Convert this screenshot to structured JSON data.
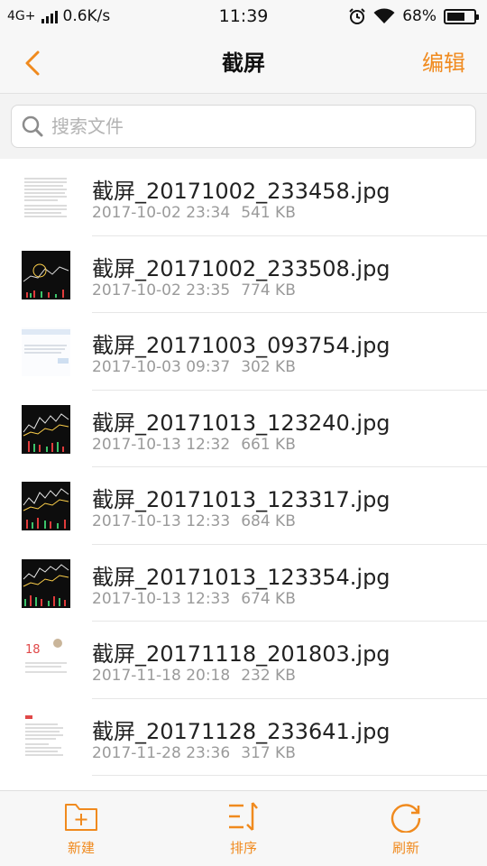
{
  "status_bar": {
    "network": "4G+",
    "speed": "0.6K/s",
    "time": "11:39",
    "battery_percent": "68%",
    "battery_level": 0.68,
    "icons": [
      "signal-icon",
      "alarm-icon",
      "wifi-icon",
      "battery-icon"
    ]
  },
  "header": {
    "back_icon": "chevron-left-icon",
    "title": "截屏",
    "edit_label": "编辑"
  },
  "search": {
    "icon": "search-icon",
    "placeholder": "搜索文件",
    "value": ""
  },
  "files": [
    {
      "name": "截屏_20171002_233458.jpg",
      "date": "2017-10-02 23:34",
      "size": "541 KB",
      "thumb": "document-text"
    },
    {
      "name": "截屏_20171002_233508.jpg",
      "date": "2017-10-02 23:35",
      "size": "774 KB",
      "thumb": "dark-chart"
    },
    {
      "name": "截屏_20171003_093754.jpg",
      "date": "2017-10-03 09:37",
      "size": "302 KB",
      "thumb": "light-page"
    },
    {
      "name": "截屏_20171013_123240.jpg",
      "date": "2017-10-13 12:32",
      "size": "661 KB",
      "thumb": "stock-chart"
    },
    {
      "name": "截屏_20171013_123317.jpg",
      "date": "2017-10-13 12:33",
      "size": "684 KB",
      "thumb": "stock-chart"
    },
    {
      "name": "截屏_20171013_123354.jpg",
      "date": "2017-10-13 12:33",
      "size": "674 KB",
      "thumb": "stock-chart"
    },
    {
      "name": "截屏_20171118_201803.jpg",
      "date": "2017-11-18 20:18",
      "size": "232 KB",
      "thumb": "calendar-page",
      "thumb_text": "18"
    },
    {
      "name": "截屏_20171128_233641.jpg",
      "date": "2017-11-28 23:36",
      "size": "317 KB",
      "thumb": "list-page"
    }
  ],
  "toolbar": {
    "new_label": "新建",
    "sort_label": "排序",
    "refresh_label": "刷新"
  },
  "colors": {
    "accent": "#f08a1e",
    "text_primary": "#222222",
    "text_secondary": "#9a9a9a"
  }
}
